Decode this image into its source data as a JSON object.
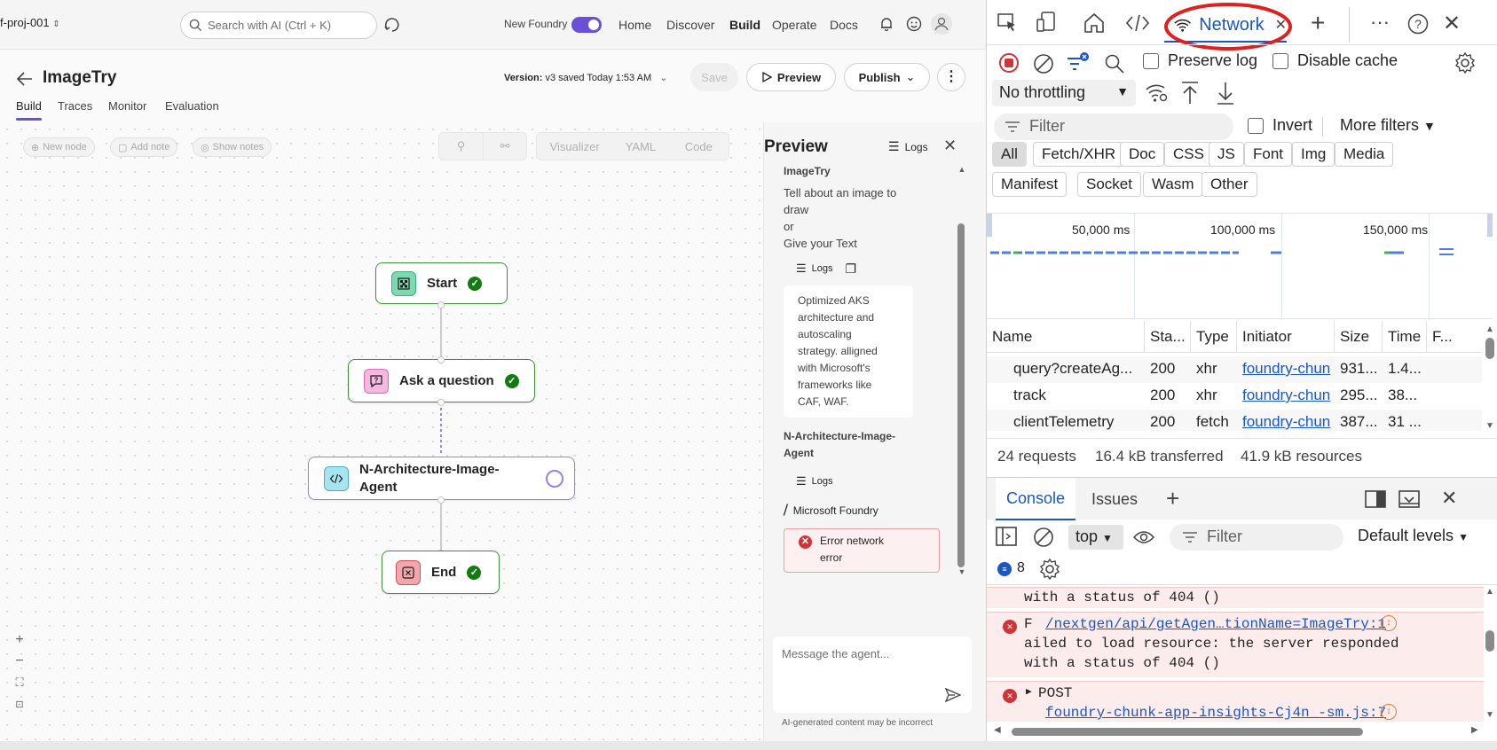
{
  "topbar": {
    "project": "f-proj-001",
    "search_placeholder": "Search with AI (Ctrl + K)",
    "new_foundry_label": "New Foundry",
    "nav": [
      "Home",
      "Discover",
      "Build",
      "Operate",
      "Docs"
    ],
    "active_nav": "Build"
  },
  "header": {
    "title": "ImageTry",
    "version_label": "Version:",
    "version_value": "v3 saved Today 1:53 AM",
    "save_label": "Save",
    "preview_label": "Preview",
    "publish_label": "Publish"
  },
  "tabs": [
    "Build",
    "Traces",
    "Monitor",
    "Evaluation"
  ],
  "toolbar": {
    "new_node": "New node",
    "add_note": "Add note",
    "show_notes": "Show notes",
    "views": [
      "Visualizer",
      "YAML",
      "Code"
    ]
  },
  "nodes": {
    "start": "Start",
    "ask": "Ask a question",
    "agent_line1": "N-Architecture-Image-",
    "agent_line2": "Agent",
    "end": "End"
  },
  "preview": {
    "title": "Preview",
    "logs_label": "Logs",
    "agent_name": "ImageTry",
    "intro_lines": [
      "Tell about an image to",
      "draw",
      "or",
      "Give your Text"
    ],
    "logs1": "Logs",
    "response_lines": [
      "Optimized AKS",
      "architecture and",
      "autoscaling",
      "strategy. alligned",
      "with Microsoft's",
      "frameworks like",
      "CAF, WAF."
    ],
    "agent2_line1": "N-Architecture-Image-",
    "agent2_line2": "Agent",
    "logs2": "Logs",
    "foundry_label": "Microsoft Foundry",
    "error_line1": "Error network",
    "error_line2": "error",
    "message_placeholder": "Message the agent...",
    "disclaimer": "AI-generated content may be incorrect"
  },
  "devtools": {
    "active_tab": "Network",
    "preserve_log": "Preserve log",
    "disable_cache": "Disable cache",
    "throttling": "No throttling",
    "filter_placeholder": "Filter",
    "invert_label": "Invert",
    "more_filters": "More filters",
    "type_filters_row1": [
      "All",
      "Fetch/XHR",
      "Doc",
      "CSS",
      "JS",
      "Font",
      "Img",
      "Media"
    ],
    "type_filters_row2": [
      "Manifest",
      "Socket",
      "Wasm",
      "Other"
    ],
    "timeline_ticks": [
      "50,000 ms",
      "100,000 ms",
      "150,000 ms"
    ],
    "columns": [
      "Name",
      "Sta...",
      "Type",
      "Initiator",
      "Size",
      "Time",
      "F..."
    ],
    "rows": [
      {
        "name": "query?createAg...",
        "status": "200",
        "type": "xhr",
        "initiator": "foundry-chun",
        "size": "931...",
        "time": "1.4..."
      },
      {
        "name": "track",
        "status": "200",
        "type": "xhr",
        "initiator": "foundry-chun",
        "size": "295...",
        "time": "38..."
      },
      {
        "name": "clientTelemetry",
        "status": "200",
        "type": "fetch",
        "initiator": "foundry-chun",
        "size": "387...",
        "time": "31 ..."
      }
    ],
    "summary": {
      "requests": "24 requests",
      "transferred": "16.4 kB transferred",
      "resources": "41.9 kB resources"
    },
    "console": {
      "tabs": [
        "Console",
        "Issues"
      ],
      "context": "top",
      "filter_placeholder": "Filter",
      "levels": "Default levels",
      "message_count": "8",
      "msg0_tail": "with a status of 404 ()",
      "msg1_prefix": "F",
      "msg1_link": "/nextgen/api/getAgen…tionName=ImageTry:1",
      "msg1_line2": "ailed to load resource: the server responded",
      "msg1_line3": "with a status of 404 ()",
      "msg2_method": "POST",
      "msg2_link": "foundry-chunk-app-insights-Cj4n_-sm.js:7"
    }
  },
  "colors": {
    "accent_purple": "#6b4fd8",
    "success_green": "#107c10",
    "error_red": "#d13438",
    "annotation_red": "#e02020"
  }
}
